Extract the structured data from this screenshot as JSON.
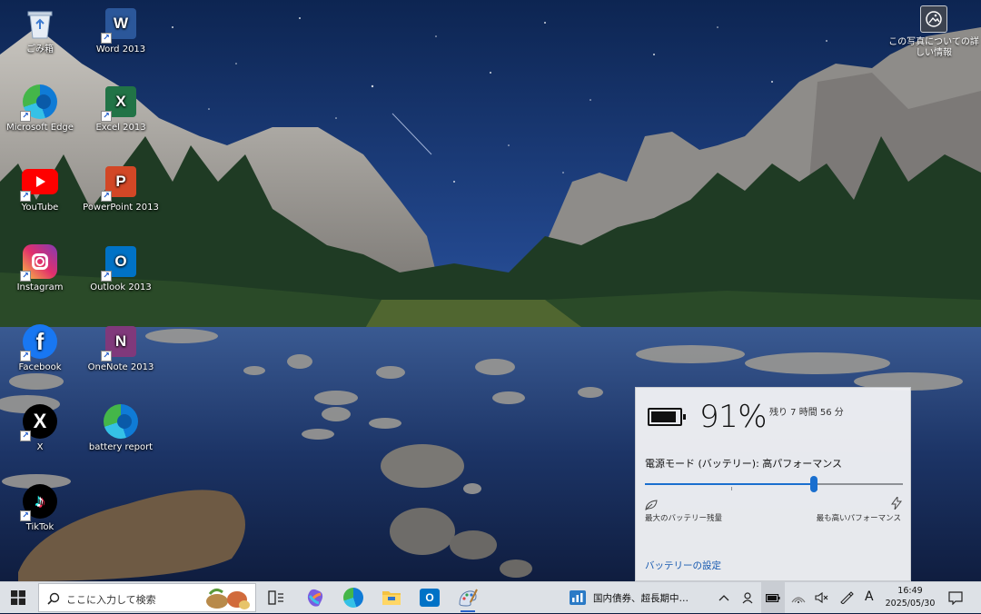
{
  "desktop": {
    "left_icons": [
      {
        "label": "ごみ箱",
        "icon": "recycle-bin-icon"
      },
      {
        "label": "Microsoft Edge",
        "icon": "edge-icon"
      },
      {
        "label": "YouTube",
        "icon": "youtube-icon"
      },
      {
        "label": "Instagram",
        "icon": "instagram-icon"
      },
      {
        "label": "Facebook",
        "icon": "facebook-icon"
      },
      {
        "label": "X",
        "icon": "x-icon"
      },
      {
        "label": "TikTok",
        "icon": "tiktok-icon"
      }
    ],
    "right_icons": [
      {
        "label": "Word 2013",
        "icon": "word-icon",
        "letter": "W",
        "color": "#2b579a"
      },
      {
        "label": "Excel 2013",
        "icon": "excel-icon",
        "letter": "X",
        "color": "#217346"
      },
      {
        "label": "PowerPoint 2013",
        "icon": "powerpoint-icon",
        "letter": "P",
        "color": "#d24726"
      },
      {
        "label": "Outlook 2013",
        "icon": "outlook-icon",
        "letter": "O",
        "color": "#0072c6"
      },
      {
        "label": "OneNote 2013",
        "icon": "onenote-icon",
        "letter": "N",
        "color": "#80397b"
      },
      {
        "label": "battery report",
        "icon": "edge-icon"
      }
    ],
    "photo_info": {
      "line1": "この写真についての詳",
      "line2": "しい情報"
    }
  },
  "battery_flyout": {
    "percent_text": "91%",
    "percent_value": 0.91,
    "remaining": "残り 7 時間 56 分",
    "mode_label": "電源モード (バッテリー): 高パフォーマンス",
    "slider_position": 0.66,
    "left_label": "最大のバッテリー残量",
    "right_label": "最も高いパフォーマンス",
    "settings_link": "バッテリーの設定",
    "accent": "#1a6fcf"
  },
  "taskbar": {
    "search_placeholder": "ここに入力して検索",
    "news_text": "国内債券、超長期中…",
    "ime_indicator": "A",
    "time": "16:49",
    "date": "2025/05/30"
  }
}
